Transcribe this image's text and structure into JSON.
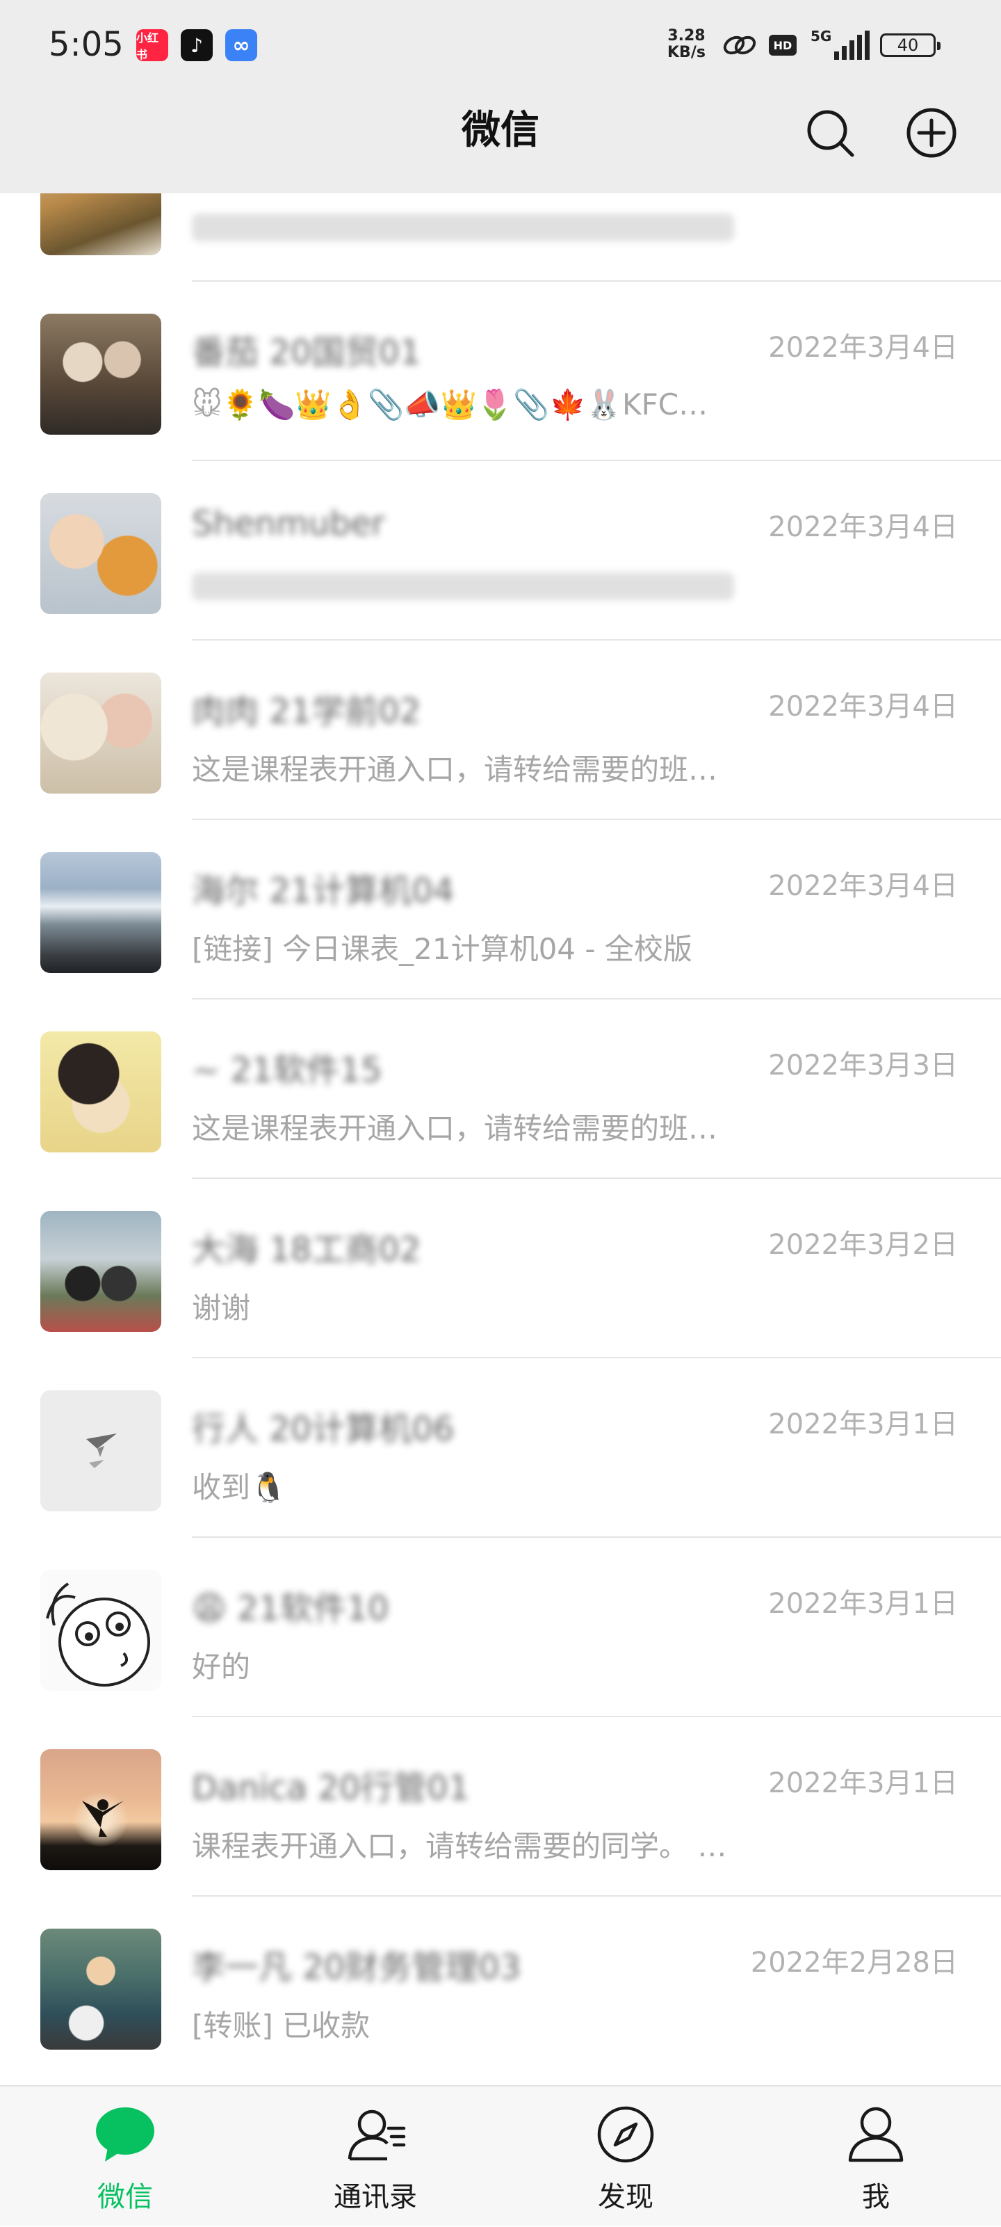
{
  "status_bar": {
    "time": "5:05",
    "apps": [
      {
        "name": "xiaohongshu",
        "label": "小红书",
        "color": "#ff2442"
      },
      {
        "name": "douyin",
        "label": "♪",
        "color": "#111111"
      },
      {
        "name": "link-app",
        "label": "∞",
        "color": "#3b82f6"
      }
    ],
    "net_speed_value": "3.28",
    "net_speed_unit": "KB/s",
    "hd": "HD",
    "network": "5G",
    "battery": "40"
  },
  "header": {
    "title": "微信"
  },
  "chats": [
    {
      "name": "",
      "time": "",
      "message": "",
      "message_blurred": true
    },
    {
      "name": "番茄 20国贸01",
      "time": "2022年3月4日",
      "message": "🐭🌻🍆👑👌📎📣👑🌷📎🍁🐰KFC…",
      "message_blurred": false
    },
    {
      "name": "Shenmuber",
      "time": "2022年3月4日",
      "message": "",
      "message_blurred": true
    },
    {
      "name": "肉肉 21学前02",
      "time": "2022年3月4日",
      "message": "这是课程表开通入口，请转给需要的班…",
      "message_blurred": false
    },
    {
      "name": "海尔 21计算机04",
      "time": "2022年3月4日",
      "message": "[链接] 今日课表_21计算机04 - 全校版",
      "message_blurred": false
    },
    {
      "name": "~ 21软件15",
      "time": "2022年3月3日",
      "message": "这是课程表开通入口，请转给需要的班…",
      "message_blurred": false
    },
    {
      "name": "大海 18工商02",
      "time": "2022年3月2日",
      "message": "谢谢",
      "message_blurred": false
    },
    {
      "name": "行人 20计算机06",
      "time": "2022年3月1日",
      "message": "收到🐧",
      "message_blurred": false
    },
    {
      "name": "😩 21软件10",
      "time": "2022年3月1日",
      "message": "好的",
      "message_blurred": false
    },
    {
      "name": "Danica 20行管01",
      "time": "2022年3月1日",
      "message": "课程表开通入口，请转给需要的同学。 …",
      "message_blurred": false
    },
    {
      "name": "李一凡 20财务管理03",
      "time": "2022年2月28日",
      "message": "[转账] 已收款",
      "message_blurred": false
    }
  ],
  "tabs": [
    {
      "label": "微信",
      "icon": "chat-bubble-icon",
      "active": true
    },
    {
      "label": "通讯录",
      "icon": "contacts-icon",
      "active": false
    },
    {
      "label": "发现",
      "icon": "compass-icon",
      "active": false
    },
    {
      "label": "我",
      "icon": "person-icon",
      "active": false
    }
  ],
  "colors": {
    "accent": "#07c160",
    "header_bg": "#ededed",
    "time_text": "#b2b2b2",
    "message_text": "#a6a6a6"
  }
}
